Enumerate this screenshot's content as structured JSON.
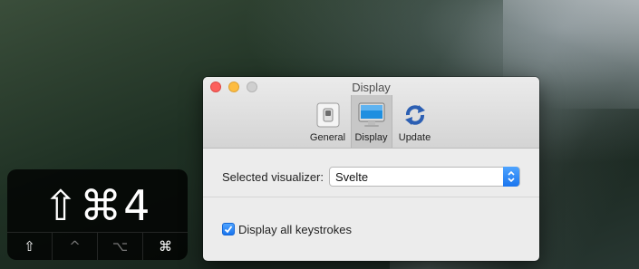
{
  "overlay": {
    "combo_text": "⇧⌘4",
    "modifiers": [
      {
        "glyph": "⇧",
        "active": true
      },
      {
        "glyph": "^",
        "active": false
      },
      {
        "glyph": "⌥",
        "active": false
      },
      {
        "glyph": "⌘",
        "active": true
      }
    ]
  },
  "window": {
    "title": "Display",
    "toolbar": {
      "items": [
        {
          "label": "General",
          "icon": "light-switch-icon"
        },
        {
          "label": "Display",
          "icon": "monitor-icon",
          "selected": true
        },
        {
          "label": "Update",
          "icon": "refresh-icon"
        }
      ]
    },
    "visualizer": {
      "label": "Selected visualizer:",
      "value": "Svelte"
    },
    "keystrokes_checkbox": {
      "label": "Display all keystrokes",
      "checked": true
    }
  },
  "colors": {
    "accent": "#1a75ee",
    "close": "#fc605c",
    "minimize": "#fdbc40",
    "zoom_disabled": "#cfcfcf"
  }
}
